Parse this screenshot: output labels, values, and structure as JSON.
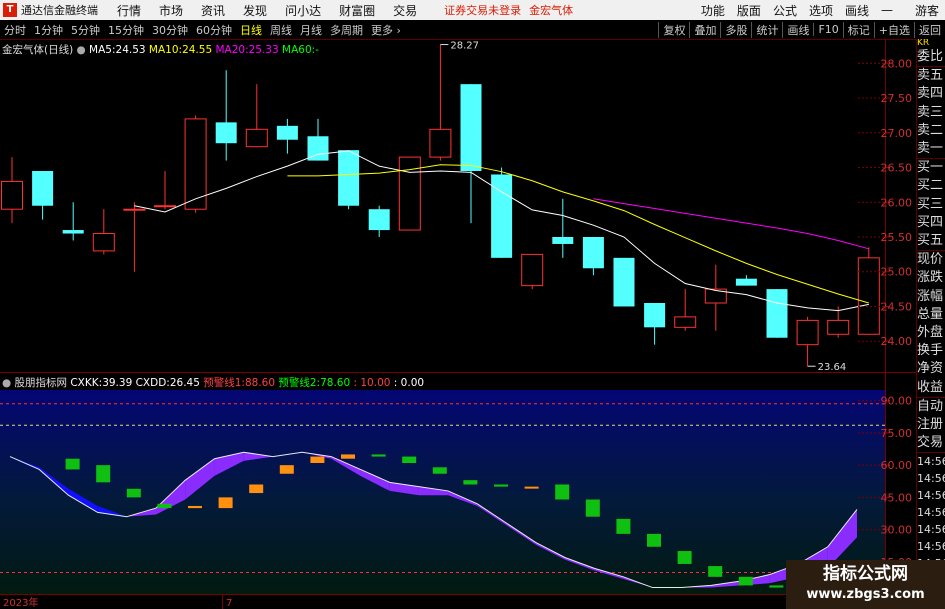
{
  "menubar": {
    "app_title": "通达信金融终端",
    "items": [
      "行情",
      "市场",
      "资讯",
      "发现",
      "问小达",
      "财富圈",
      "交易"
    ],
    "status": "证券交易未登录",
    "stock": "金宏气体",
    "right_items": [
      "功能",
      "版面",
      "公式",
      "选项",
      "画线",
      "游客"
    ]
  },
  "toolbar": {
    "periods": [
      "分时",
      "1分钟",
      "5分钟",
      "15分钟",
      "30分钟",
      "60分钟",
      "日线",
      "周线",
      "月线",
      "多周期",
      "更多"
    ],
    "active_period": "日线",
    "right_buttons": [
      "复权",
      "叠加",
      "多股",
      "统计",
      "画线",
      "F10",
      "标记",
      "+自选",
      "返回"
    ]
  },
  "main_chart": {
    "title": "金宏气体",
    "period_tag": "(日线)",
    "ma5_label": "MA5:",
    "ma5_value": "24.53",
    "ma10_label": "MA10:",
    "ma10_value": "24.55",
    "ma20_label": "MA20:",
    "ma20_value": "25.33",
    "ma60_label": "MA60:",
    "ma60_value": "-",
    "high_marker": "28.27",
    "low_marker": "23.64",
    "y_ticks": [
      "28.00",
      "27.50",
      "27.00",
      "26.50",
      "26.00",
      "25.50",
      "25.00",
      "24.50",
      "24.00"
    ]
  },
  "indicator": {
    "name": "股朋指标网",
    "cxkk_label": "CXKK:",
    "cxkk_value": "39.39",
    "cxdd_label": "CXDD:",
    "cxdd_value": "26.45",
    "warn1_label": "预警线1:",
    "warn1_value": "88.60",
    "warn2_label": "预警线2:",
    "warn2_value": "78.60",
    "v3": "10.00",
    "v4": "0.00",
    "y_ticks": [
      "90.00",
      "75.00",
      "60.00",
      "45.00",
      "30.00",
      "15.00"
    ]
  },
  "x_axis": {
    "year_label": "2023年",
    "month_label": "7"
  },
  "sidebar": {
    "top": [
      "KR",
      "委比",
      "卖五",
      "卖四",
      "卖三",
      "卖二",
      "卖一",
      "买一",
      "买二",
      "买三",
      "买四",
      "买五",
      "现价",
      "涨跌",
      "涨幅",
      "总量",
      "外盘",
      "换手",
      "净资",
      "收益"
    ],
    "bottom": [
      "自动",
      "注册",
      "交易",
      "14:56",
      "14:56",
      "14:56",
      "14:56",
      "14:56",
      "14:56",
      "14:56"
    ]
  },
  "watermark": {
    "line1": "指标公式网",
    "line2": "www.zbgs3.com"
  },
  "colors": {
    "up": "#ff3232",
    "down": "#54ffff",
    "ma5": "#ffffff",
    "ma10": "#ffff00",
    "ma20": "#ff00ff",
    "ma60": "#00ff00",
    "fill_up": "#8b2cff",
    "fill_down": "#1010ff",
    "bar_green": "#10c010",
    "bar_orange": "#ff9010"
  },
  "chart_data": {
    "type": "candlestick",
    "price_range": [
      23.6,
      28.35
    ],
    "candles": [
      {
        "o": 25.9,
        "h": 26.65,
        "l": 25.7,
        "c": 26.3
      },
      {
        "o": 26.45,
        "h": 26.45,
        "l": 25.75,
        "c": 25.95
      },
      {
        "o": 25.6,
        "h": 26.0,
        "l": 25.45,
        "c": 25.55
      },
      {
        "o": 25.3,
        "h": 25.9,
        "l": 25.25,
        "c": 25.55
      },
      {
        "o": 25.9,
        "h": 26.0,
        "l": 25.0,
        "c": 25.9
      },
      {
        "o": 25.95,
        "h": 26.45,
        "l": 25.9,
        "c": 25.95
      },
      {
        "o": 25.9,
        "h": 27.25,
        "l": 25.85,
        "c": 27.2
      },
      {
        "o": 27.15,
        "h": 27.9,
        "l": 26.6,
        "c": 26.85
      },
      {
        "o": 26.8,
        "h": 27.7,
        "l": 26.8,
        "c": 27.05
      },
      {
        "o": 27.1,
        "h": 27.2,
        "l": 26.7,
        "c": 26.9
      },
      {
        "o": 26.95,
        "h": 27.2,
        "l": 26.6,
        "c": 26.6
      },
      {
        "o": 26.75,
        "h": 26.75,
        "l": 25.9,
        "c": 25.95
      },
      {
        "o": 25.9,
        "h": 25.95,
        "l": 25.5,
        "c": 25.6
      },
      {
        "o": 25.6,
        "h": 26.65,
        "l": 25.6,
        "c": 26.65
      },
      {
        "o": 26.65,
        "h": 28.27,
        "l": 26.6,
        "c": 27.05
      },
      {
        "o": 27.7,
        "h": 27.7,
        "l": 25.7,
        "c": 26.45
      },
      {
        "o": 26.4,
        "h": 26.5,
        "l": 25.2,
        "c": 25.2
      },
      {
        "o": 24.8,
        "h": 25.25,
        "l": 24.75,
        "c": 25.25
      },
      {
        "o": 25.5,
        "h": 26.05,
        "l": 25.2,
        "c": 25.4
      },
      {
        "o": 25.5,
        "h": 25.5,
        "l": 24.95,
        "c": 25.05
      },
      {
        "o": 25.2,
        "h": 25.2,
        "l": 24.5,
        "c": 24.5
      },
      {
        "o": 24.55,
        "h": 24.55,
        "l": 23.95,
        "c": 24.2
      },
      {
        "o": 24.2,
        "h": 24.75,
        "l": 24.15,
        "c": 24.35
      },
      {
        "o": 24.55,
        "h": 25.1,
        "l": 24.15,
        "c": 24.75
      },
      {
        "o": 24.9,
        "h": 24.95,
        "l": 24.8,
        "c": 24.8
      },
      {
        "o": 24.75,
        "h": 24.75,
        "l": 24.05,
        "c": 24.05
      },
      {
        "o": 23.95,
        "h": 24.35,
        "l": 23.64,
        "c": 24.3
      },
      {
        "o": 24.1,
        "h": 24.5,
        "l": 24.05,
        "c": 24.3
      },
      {
        "o": 24.1,
        "h": 25.35,
        "l": 24.1,
        "c": 25.2
      }
    ],
    "ma5": [
      null,
      null,
      null,
      null,
      25.95,
      25.86,
      26.05,
      26.2,
      26.37,
      26.52,
      26.69,
      26.74,
      26.52,
      26.43,
      26.45,
      26.43,
      26.15,
      25.89,
      25.81,
      25.67,
      25.5,
      25.12,
      24.83,
      24.73,
      24.67,
      24.55,
      24.48,
      24.44,
      24.53
    ],
    "ma10": [
      null,
      null,
      null,
      null,
      null,
      null,
      null,
      null,
      null,
      26.38,
      26.38,
      26.4,
      26.42,
      26.47,
      26.54,
      26.53,
      26.44,
      26.31,
      26.15,
      26.02,
      25.88,
      25.68,
      25.49,
      25.3,
      25.12,
      24.96,
      24.82,
      24.68,
      24.55
    ],
    "ma20": [
      null,
      null,
      null,
      null,
      null,
      null,
      null,
      null,
      null,
      null,
      null,
      null,
      null,
      null,
      null,
      null,
      null,
      null,
      null,
      26.05,
      25.98,
      25.91,
      25.84,
      25.77,
      25.7,
      25.63,
      25.55,
      25.45,
      25.33
    ],
    "indicator_range": [
      0,
      95
    ],
    "ind_upper": [
      64,
      58,
      46,
      38,
      36,
      40,
      53,
      63,
      66,
      64,
      66,
      64,
      58,
      52,
      50,
      48,
      42,
      33,
      24,
      17,
      12,
      8,
      3,
      3,
      4,
      6,
      9,
      14,
      22,
      39.39
    ],
    "ind_lower": [
      64,
      59,
      49,
      41,
      36,
      37,
      44,
      55,
      62,
      64,
      66,
      63,
      55,
      48,
      46,
      46,
      41,
      32,
      23,
      16,
      11,
      7,
      3,
      3,
      3,
      4,
      5,
      8,
      12,
      26.45
    ],
    "ind_bars": [
      {
        "v1": 63,
        "v2": 58
      },
      {
        "v1": 60,
        "v2": 52
      },
      {
        "v1": 49,
        "v2": 45
      },
      {
        "v1": 42,
        "v2": 40
      },
      {
        "v1": 40,
        "v2": 41
      },
      {
        "v1": 40,
        "v2": 45
      },
      {
        "v1": 47,
        "v2": 51
      },
      {
        "v1": 56,
        "v2": 60
      },
      {
        "v1": 61,
        "v2": 64
      },
      {
        "v1": 63,
        "v2": 65
      },
      {
        "v1": 65,
        "v2": 64
      },
      {
        "v1": 64,
        "v2": 61
      },
      {
        "v1": 59,
        "v2": 56
      },
      {
        "v1": 53,
        "v2": 51
      },
      {
        "v1": 51,
        "v2": 50
      },
      {
        "v1": 50,
        "v2": 50
      },
      {
        "v1": 51,
        "v2": 44
      },
      {
        "v1": 44,
        "v2": 36
      },
      {
        "v1": 35,
        "v2": 28
      },
      {
        "v1": 28,
        "v2": 22
      },
      {
        "v1": 20,
        "v2": 14
      },
      {
        "v1": 13,
        "v2": 8
      },
      {
        "v1": 8,
        "v2": 4
      },
      {
        "v1": 4,
        "v2": 3
      },
      {
        "v1": 3,
        "v2": 2
      },
      {
        "v1": 2,
        "v2": 1
      },
      {
        "v1": 2,
        "v2": 1
      },
      {
        "v1": 2,
        "v2": 1
      }
    ],
    "warn1": 88.6,
    "warn2": 78.6,
    "line3": 10.0
  }
}
